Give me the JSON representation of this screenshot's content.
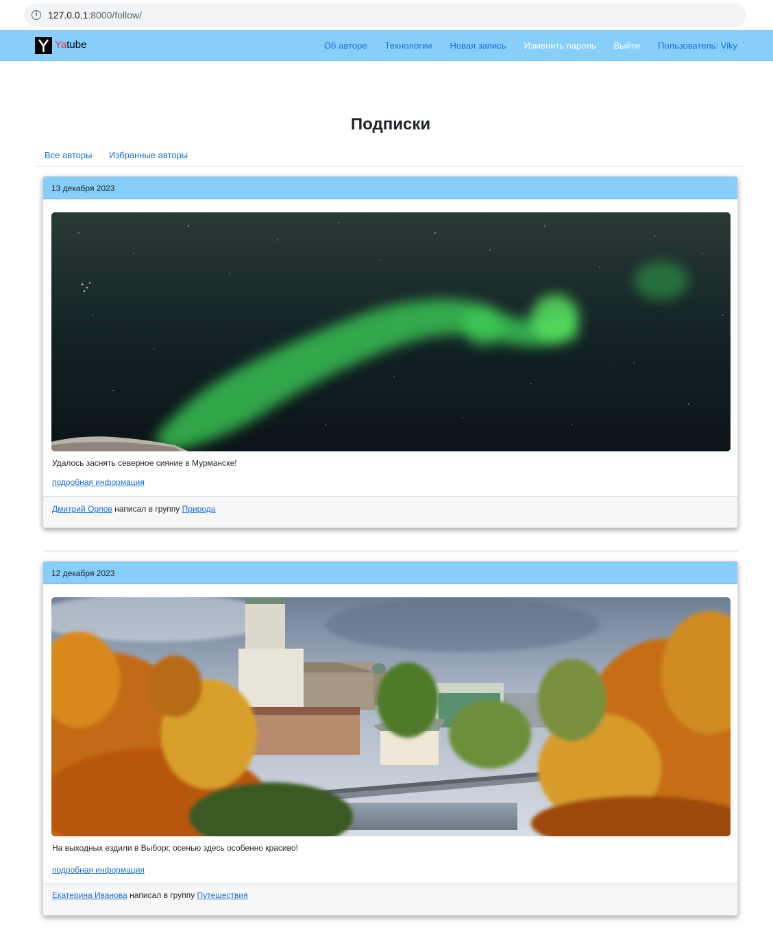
{
  "browser": {
    "url_host": "127.0.0.1",
    "url_path": ":8000/follow/"
  },
  "navbar": {
    "brand_ya": "Ya",
    "brand_tube": "tube",
    "links": [
      {
        "label": "Об авторе"
      },
      {
        "label": "Технологии"
      },
      {
        "label": "Новая запись"
      },
      {
        "label": "Изменить пароль"
      },
      {
        "label": "Выйти"
      },
      {
        "label": "Пользователь: Viky"
      }
    ]
  },
  "page": {
    "title": "Подписки"
  },
  "tabs": {
    "all_authors": "Все авторы",
    "favorite_authors": "Избранные авторы"
  },
  "posts": [
    {
      "date": "13 декабря 2023",
      "image_icon": "aurora-photo",
      "text": "Удалось заснять северное сияние в Мурманске!",
      "more_label": "подробная информация",
      "author": "Дмитрий Орлов",
      "wrote_in": " написал в группу ",
      "group": "Природа"
    },
    {
      "date": "12 декабря 2023",
      "image_icon": "vyborg-castle-photo",
      "text": "На выходных ездили в Выборг, осенью здесь особенно красиво!",
      "more_label": "подробная информация",
      "author": "Екатерина Иванова",
      "wrote_in": " написал в группу ",
      "group": "Путешествия"
    }
  ]
}
